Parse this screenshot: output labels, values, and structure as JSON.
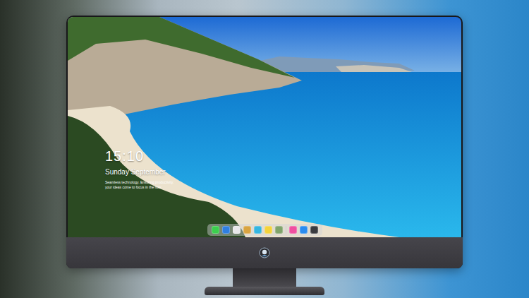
{
  "lock_screen": {
    "time": "15:10",
    "date": "Sunday September",
    "tagline": [
      "Seamless technology. Ensuring productivity.",
      "your ideas come to focus in the flow."
    ]
  },
  "dock": {
    "items": [
      {
        "kind": "app",
        "color": "#3ccf4e"
      },
      {
        "kind": "app",
        "color": "#2f7fe0"
      },
      {
        "kind": "app",
        "color": "#e8e8ea"
      },
      {
        "kind": "app",
        "color": "#d9a441"
      },
      {
        "kind": "app",
        "color": "#35b6e0"
      },
      {
        "kind": "app",
        "color": "#f5d33a"
      },
      {
        "kind": "app",
        "color": "#7fa36a"
      },
      {
        "kind": "separator",
        "color": "#cfcfcf"
      },
      {
        "kind": "app",
        "color": "#f04fa0"
      },
      {
        "kind": "app",
        "color": "#2a8cf0"
      },
      {
        "kind": "app",
        "color": "#3b3b3f"
      }
    ]
  }
}
